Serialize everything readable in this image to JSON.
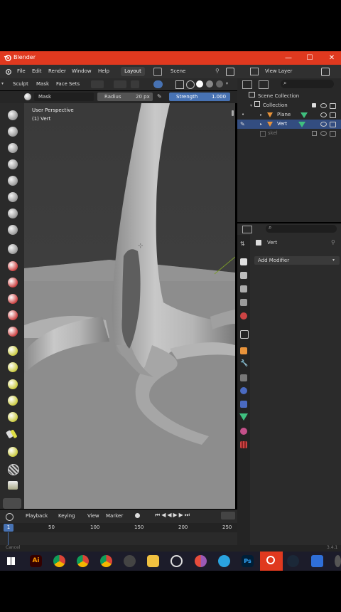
{
  "window": {
    "title": "Blender",
    "minimize": "—",
    "maximize": "☐",
    "close": "✕"
  },
  "menubar": {
    "items": [
      "File",
      "Edit",
      "Render",
      "Window",
      "Help"
    ],
    "workspace_tab": "Layout",
    "scene": "Scene",
    "view_layer": "View Layer"
  },
  "sculpt_header": {
    "items": [
      "Sculpt",
      "Mask",
      "Face Sets"
    ]
  },
  "tool_options": {
    "brush_name": "Mask",
    "radius_label": "Radius",
    "radius_value": "20 px",
    "strength_label": "Strength",
    "strength_value": "1.000"
  },
  "viewport": {
    "perspective": "User Perspective",
    "object": "(1) Vert"
  },
  "outliner": {
    "root": "Scene Collection",
    "items": [
      {
        "name": "Collection",
        "indent": 1
      },
      {
        "name": "Plane",
        "indent": 2
      },
      {
        "name": "Vert",
        "indent": 2,
        "selected": true
      },
      {
        "name": "skel",
        "indent": 1,
        "dim": true
      }
    ]
  },
  "properties": {
    "object_name": "Vert",
    "add_modifier": "Add Modifier"
  },
  "timeline": {
    "menus": [
      "Playback",
      "Keying",
      "View",
      "Marker"
    ],
    "current_frame": "1",
    "ticks": [
      "50",
      "100",
      "150",
      "200",
      "250"
    ]
  },
  "status": {
    "left": "Cancel",
    "right": "3.4.1"
  },
  "taskbar": {
    "apps": [
      "windows",
      "illustrator",
      "chrome",
      "chrome",
      "chrome",
      "store",
      "files",
      "obs",
      "chrome",
      "telegram",
      "photoshop",
      "blender",
      "steam",
      "network"
    ],
    "ai_label": "Ai",
    "ps_label": "Ps"
  },
  "colors": {
    "accent": "#e0391f",
    "selection": "#334d80",
    "field_blue": "#4772b3"
  }
}
